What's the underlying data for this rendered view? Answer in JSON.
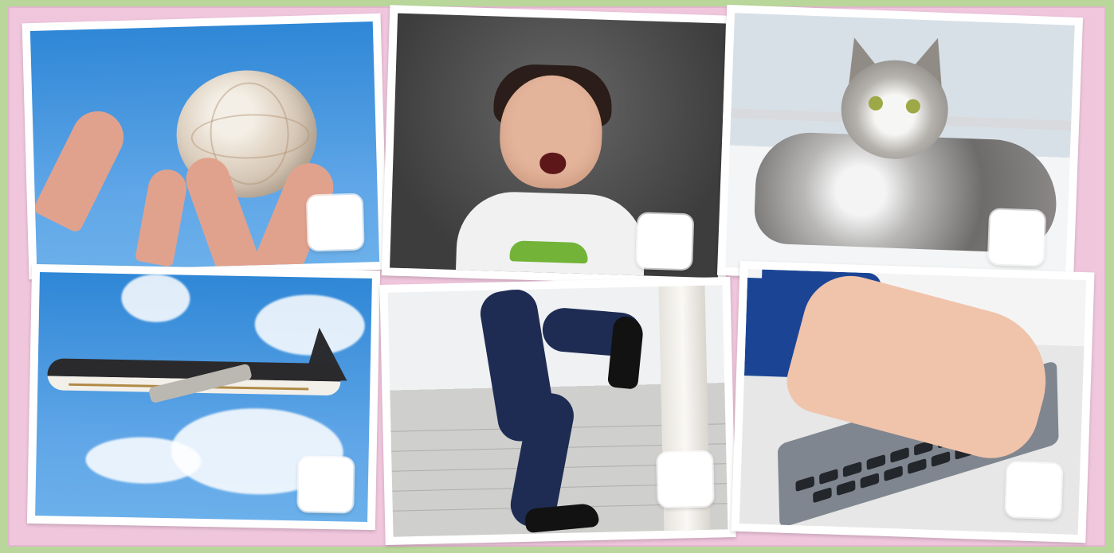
{
  "page": {
    "background_color": "#b9d79a",
    "paper_color": "#f0c6dd",
    "frame_color": "#ffffff"
  },
  "cards": [
    {
      "icon": "volleyball-icon"
    },
    {
      "icon": "crying-child-icon"
    },
    {
      "icon": "cat-icon"
    },
    {
      "icon": "airplane-icon"
    },
    {
      "icon": "stairs-icon"
    },
    {
      "icon": "keyboard-icon"
    }
  ]
}
